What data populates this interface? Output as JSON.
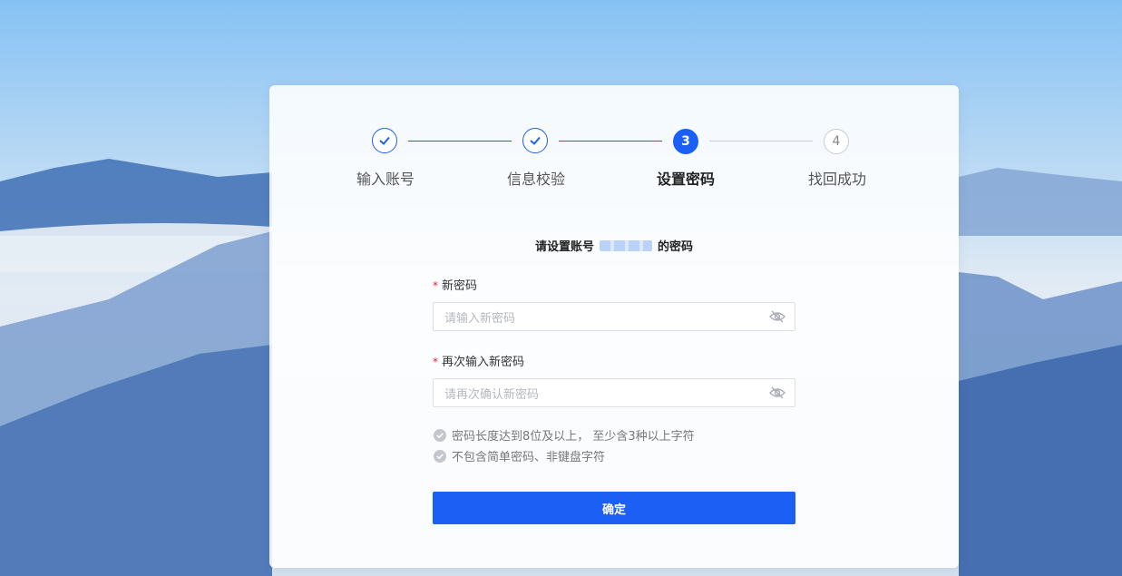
{
  "steps": [
    {
      "label": "输入账号",
      "state": "done",
      "icon": "check-icon"
    },
    {
      "label": "信息校验",
      "state": "done",
      "icon": "check-icon"
    },
    {
      "label": "设置密码",
      "state": "active",
      "number": "3"
    },
    {
      "label": "找回成功",
      "state": "todo",
      "number": "4"
    }
  ],
  "form": {
    "title_prefix": "请设置账号",
    "title_suffix": "的密码",
    "new_password": {
      "label": "新密码",
      "required_mark": "*",
      "placeholder": "请输入新密码"
    },
    "confirm_password": {
      "label": "再次输入新密码",
      "required_mark": "*",
      "placeholder": "请再次确认新密码"
    },
    "rules": [
      "密码长度达到8位及以上， 至少含3种以上字符",
      "不包含简单密码、非键盘字符"
    ],
    "submit_label": "确定"
  },
  "colors": {
    "accent": "#1c5ff5",
    "inactive": "#c8ccd3",
    "required": "#ee2233"
  }
}
